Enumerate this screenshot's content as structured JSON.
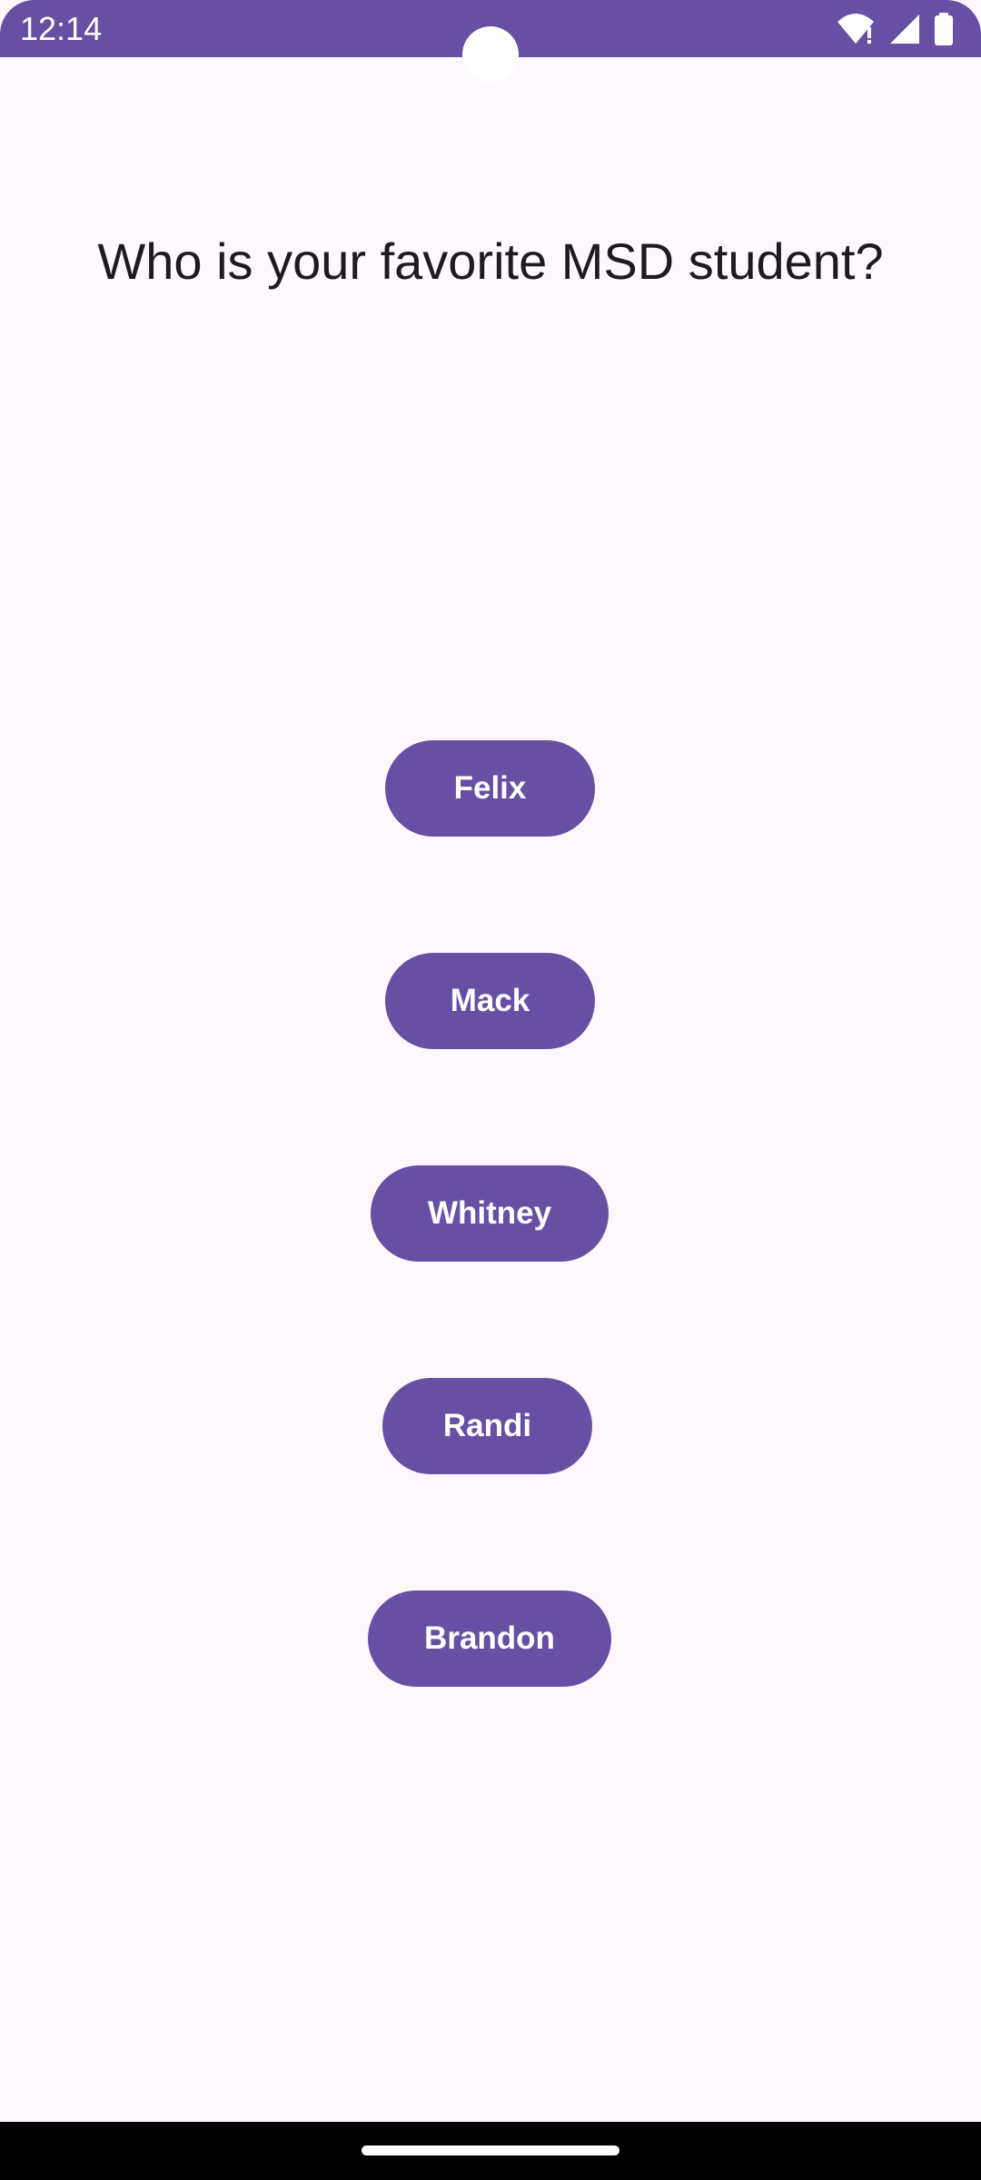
{
  "status_bar": {
    "time": "12:14",
    "icons": [
      "wifi-icon",
      "cell-signal-icon",
      "battery-icon"
    ],
    "color": "#6750A4"
  },
  "main": {
    "question": "Who is your favorite MSD student?",
    "choices": [
      {
        "label": "Felix"
      },
      {
        "label": "Mack"
      },
      {
        "label": "Whitney"
      },
      {
        "label": "Randi"
      },
      {
        "label": "Brandon"
      }
    ]
  },
  "colors": {
    "accent": "#6750A4",
    "background": "#FFF8FD",
    "text": "#1D1B20"
  }
}
